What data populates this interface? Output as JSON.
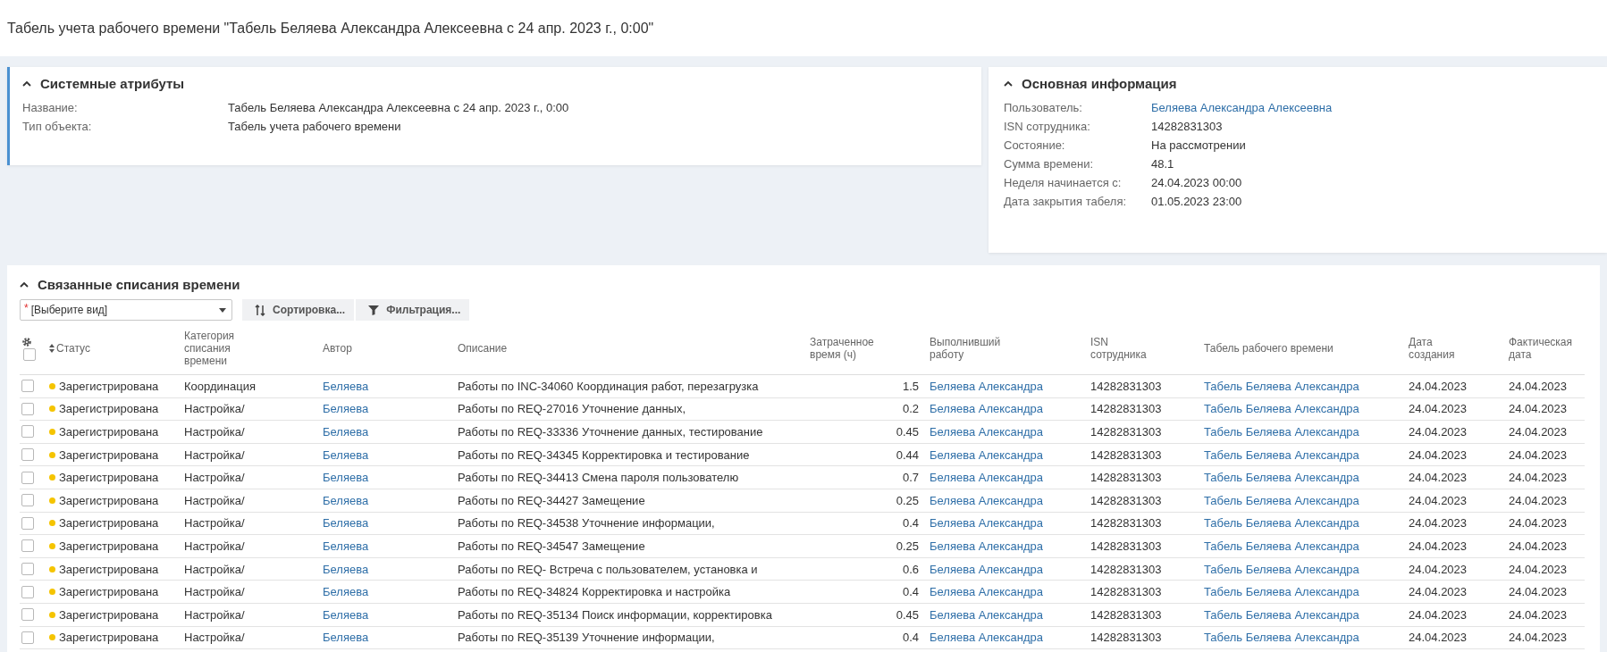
{
  "title": "Табель учета рабочего времени \"Табель Беляева Александра Алексеевна с 24 апр. 2023 г., 0:00\"",
  "system_attributes": {
    "title": "Системные атрибуты",
    "expanded": true,
    "fields": [
      {
        "label": "Название:",
        "value": "Табель Беляева Александра Алексеевна с 24 апр. 2023 г., 0:00"
      },
      {
        "label": "Тип объекта:",
        "value": "Табель учета рабочего времени"
      }
    ]
  },
  "main_info": {
    "title": "Основная информация",
    "expanded": true,
    "fields": [
      {
        "label": "Пользователь:",
        "value": "Беляева Александра Алексеевна",
        "kind": "link"
      },
      {
        "label": "ISN сотрудника:",
        "value": "14282831303",
        "kind": "text"
      },
      {
        "label": "Состояние:",
        "value": "На рассмотрении",
        "kind": "text"
      },
      {
        "label": "Сумма времени:",
        "value": "48.1",
        "kind": "text"
      },
      {
        "label": "Неделя начинается с:",
        "value": "24.04.2023 00:00",
        "kind": "text"
      },
      {
        "label": "Дата закрытия табеля:",
        "value": "01.05.2023 23:00",
        "kind": "text"
      }
    ]
  },
  "related": {
    "title": "Связанные списания времени",
    "expanded": true,
    "view_select": {
      "required_mark": "*",
      "value": "[Выберите вид]"
    },
    "buttons": [
      {
        "kind": "sort",
        "label": "Сортировка..."
      },
      {
        "kind": "filter",
        "label": "Фильтрация..."
      }
    ],
    "select_all": {
      "checked": false
    },
    "columns": [
      {
        "label": "Статус",
        "sortable": true
      },
      {
        "label": "Категория списания времени",
        "sortable": false
      },
      {
        "label": "Автор",
        "sortable": false
      },
      {
        "label": "Описание",
        "sortable": false
      },
      {
        "label": "Затраченное время (ч)",
        "sortable": false
      },
      {
        "label": "Выполнивший работу",
        "sortable": false
      },
      {
        "label": "ISN сотрудника",
        "sortable": false
      },
      {
        "label": "Табель рабочего времени",
        "sortable": false
      },
      {
        "label": "Дата создания",
        "sortable": false
      },
      {
        "label": "Фактическая дата",
        "sortable": false
      }
    ],
    "rows": [
      {
        "checked": false,
        "status": "Зарегистрирована",
        "color": "#f5c400",
        "category": "Координация",
        "author": "Беляева",
        "description": "Работы по INC-34060 Координация работ, перезагрузка",
        "hours": "1.5",
        "performer": "Беляева Александра",
        "isn": "14282831303",
        "timesheet": "Табель Беляева Александра",
        "created": "24.04.2023",
        "actual": "24.04.2023"
      },
      {
        "checked": false,
        "status": "Зарегистрирована",
        "color": "#f5c400",
        "category": "Настройка/",
        "author": "Беляева",
        "description": "Работы по REQ-27016 Уточнение данных,",
        "hours": "0.2",
        "performer": "Беляева Александра",
        "isn": "14282831303",
        "timesheet": "Табель Беляева Александра",
        "created": "24.04.2023",
        "actual": "24.04.2023"
      },
      {
        "checked": false,
        "status": "Зарегистрирована",
        "color": "#f5c400",
        "category": "Настройка/",
        "author": "Беляева",
        "description": "Работы по REQ-33336 Уточнение данных, тестирование",
        "hours": "0.45",
        "performer": "Беляева Александра",
        "isn": "14282831303",
        "timesheet": "Табель Беляева Александра",
        "created": "24.04.2023",
        "actual": "24.04.2023"
      },
      {
        "checked": false,
        "status": "Зарегистрирована",
        "color": "#f5c400",
        "category": "Настройка/",
        "author": "Беляева",
        "description": "Работы по REQ-34345 Корректировка и тестирование",
        "hours": "0.44",
        "performer": "Беляева Александра",
        "isn": "14282831303",
        "timesheet": "Табель Беляева Александра",
        "created": "24.04.2023",
        "actual": "24.04.2023"
      },
      {
        "checked": false,
        "status": "Зарегистрирована",
        "color": "#f5c400",
        "category": "Настройка/",
        "author": "Беляева",
        "description": "Работы по REQ-34413 Смена пароля пользователю",
        "hours": "0.7",
        "performer": "Беляева Александра",
        "isn": "14282831303",
        "timesheet": "Табель Беляева Александра",
        "created": "24.04.2023",
        "actual": "24.04.2023"
      },
      {
        "checked": false,
        "status": "Зарегистрирована",
        "color": "#f5c400",
        "category": "Настройка/",
        "author": "Беляева",
        "description": "Работы по REQ-34427 Замещение",
        "hours": "0.25",
        "performer": "Беляева Александра",
        "isn": "14282831303",
        "timesheet": "Табель Беляева Александра",
        "created": "24.04.2023",
        "actual": "24.04.2023"
      },
      {
        "checked": false,
        "status": "Зарегистрирована",
        "color": "#f5c400",
        "category": "Настройка/",
        "author": "Беляева",
        "description": "Работы по REQ-34538 Уточнение информации,",
        "hours": "0.4",
        "performer": "Беляева Александра",
        "isn": "14282831303",
        "timesheet": "Табель Беляева Александра",
        "created": "24.04.2023",
        "actual": "24.04.2023"
      },
      {
        "checked": false,
        "status": "Зарегистрирована",
        "color": "#f5c400",
        "category": "Настройка/",
        "author": "Беляева",
        "description": "Работы по REQ-34547  Замещение",
        "hours": "0.25",
        "performer": "Беляева Александра",
        "isn": "14282831303",
        "timesheet": "Табель Беляева Александра",
        "created": "24.04.2023",
        "actual": "24.04.2023"
      },
      {
        "checked": false,
        "status": "Зарегистрирована",
        "color": "#f5c400",
        "category": "Настройка/",
        "author": "Беляева",
        "description": "Работы по REQ- Встреча с пользователем, установка и",
        "hours": "0.6",
        "performer": "Беляева Александра",
        "isn": "14282831303",
        "timesheet": "Табель Беляева Александра",
        "created": "24.04.2023",
        "actual": "24.04.2023"
      },
      {
        "checked": false,
        "status": "Зарегистрирована",
        "color": "#f5c400",
        "category": "Настройка/",
        "author": "Беляева",
        "description": "Работы по REQ-34824 Корректировка и настройка",
        "hours": "0.4",
        "performer": "Беляева Александра",
        "isn": "14282831303",
        "timesheet": "Табель Беляева Александра",
        "created": "24.04.2023",
        "actual": "24.04.2023"
      },
      {
        "checked": false,
        "status": "Зарегистрирована",
        "color": "#f5c400",
        "category": "Настройка/",
        "author": "Беляева",
        "description": "Работы по REQ-35134 Поиск информации, корректировка",
        "hours": "0.45",
        "performer": "Беляева Александра",
        "isn": "14282831303",
        "timesheet": "Табель Беляева Александра",
        "created": "24.04.2023",
        "actual": "24.04.2023"
      },
      {
        "checked": false,
        "status": "Зарегистрирована",
        "color": "#f5c400",
        "category": "Настройка/",
        "author": "Беляева",
        "description": "Работы по REQ-35139 Уточнение информации,",
        "hours": "0.4",
        "performer": "Беляева Александра",
        "isn": "14282831303",
        "timesheet": "Табель Беляева Александра",
        "created": "24.04.2023",
        "actual": "24.04.2023"
      }
    ]
  }
}
